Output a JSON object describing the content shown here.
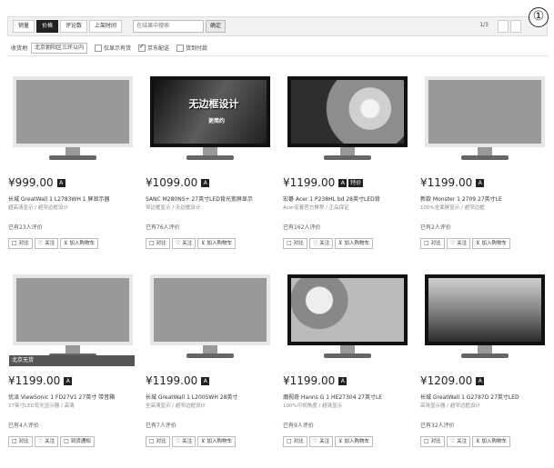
{
  "sortbar": {
    "items": [
      "销量",
      "价格",
      "评论数",
      "上架时间"
    ],
    "active_index": 1,
    "search_placeholder": "在结果中搜索",
    "search_button": "确定",
    "pager_text": "1/3"
  },
  "annotation": "①",
  "filterbar": {
    "ship_to_label": "收货地",
    "ship_to_value": "北京朝阳区三环以内",
    "checkboxes": [
      {
        "label": "仅显示有货",
        "checked": false
      },
      {
        "label": "京东配送",
        "checked": true
      },
      {
        "label": "货到付款",
        "checked": false
      }
    ]
  },
  "products": [
    {
      "screen_text": "",
      "screen_sub": "",
      "promo": "",
      "price": "¥999.00",
      "badge": "",
      "title": "长城 GreatWall 1 L2783WH 1 屏显示器",
      "desc": "超高清显示 / 超窄边框设计",
      "reviews": "已有23人评价",
      "actions": [
        "对比",
        "关注",
        "加入购物车"
      ]
    },
    {
      "screen_text": "无边框设计",
      "screen_sub": "更简约",
      "promo": "",
      "price": "¥1099.00",
      "badge": "",
      "title": "SANC M280NS+ 27英寸LED背光宽屏显示",
      "desc": "窄边框显示 / 无边框设计",
      "reviews": "已有76人评价",
      "actions": [
        "对比",
        "关注",
        "加入购物车"
      ]
    },
    {
      "screen_text": "",
      "screen_sub": "",
      "promo": "",
      "price": "¥1199.00",
      "badge": "特价",
      "title": "宏碁 Acer 1 P238HL bd 28英寸LED背",
      "desc": "Acer宏碁官方推荐 / 正品保证",
      "reviews": "已有162人评价",
      "actions": [
        "对比",
        "关注",
        "加入购物车"
      ]
    },
    {
      "screen_text": "",
      "screen_sub": "",
      "promo": "",
      "price": "¥1199.00",
      "badge": "",
      "title": "新款 Monster 1 2709 27英寸LE",
      "desc": "100%全面屏显示 / 超窄边框",
      "reviews": "已有2人评价",
      "actions": [
        "对比",
        "关注",
        "加入购物车"
      ]
    },
    {
      "screen_text": "",
      "screen_sub": "",
      "promo": "北京无货",
      "price": "¥1199.00",
      "badge": "",
      "title": "优派 ViewSonic 1 FD27V1 27英寸 带音箱",
      "desc": "27英寸LED背光显示器 / 高清",
      "reviews": "已有4人评价",
      "actions": [
        "对比",
        "关注",
        "到货通知"
      ]
    },
    {
      "screen_text": "",
      "screen_sub": "",
      "promo": "",
      "price": "¥1199.00",
      "badge": "",
      "title": "长城 GreatWall 1 L2005WH 28英寸",
      "desc": "全高清显示 / 超窄边框设计",
      "reviews": "已有7人评价",
      "actions": [
        "对比",
        "关注",
        "加入购物车"
      ]
    },
    {
      "screen_text": "",
      "screen_sub": "",
      "promo": "",
      "price": "¥1199.00",
      "badge": "",
      "title": "瀚视奇 Hanns G 1 HE27304 27英寸LE",
      "desc": "100%可视角度 / 超清显示",
      "reviews": "已有9人评价",
      "actions": [
        "对比",
        "关注",
        "加入购物车"
      ]
    },
    {
      "screen_text": "",
      "screen_sub": "",
      "promo": "",
      "price": "¥1209.00",
      "badge": "",
      "title": "长城 GreatWall 1 G2787D 27英寸LED",
      "desc": "高清显示器 / 超窄边框设计",
      "reviews": "已有32人评价",
      "actions": [
        "对比",
        "关注",
        "加入购物车"
      ]
    }
  ]
}
